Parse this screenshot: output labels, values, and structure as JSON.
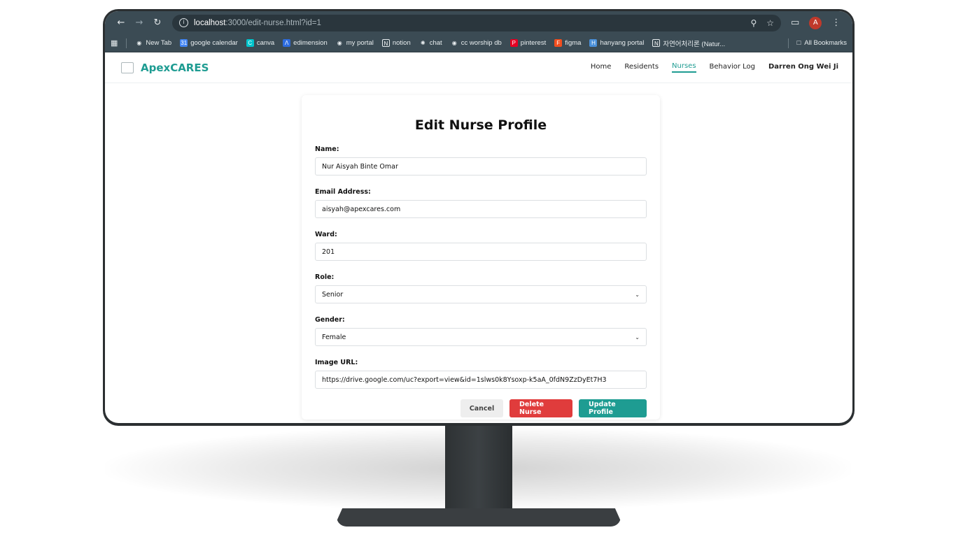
{
  "browser": {
    "url_host": "localhost",
    "url_rest": ":3000/edit-nurse.html?id=1"
  },
  "bookmarks": [
    {
      "label": "New Tab",
      "icon": "globe-icon",
      "color": "#e8edef"
    },
    {
      "label": "google calendar",
      "icon": "calendar-icon",
      "color": "#4285f4"
    },
    {
      "label": "canva",
      "icon": "canva-icon",
      "color": "#00c4cc"
    },
    {
      "label": "edimension",
      "icon": "edimension-icon",
      "color": "#2d6cdf"
    },
    {
      "label": "my portal",
      "icon": "globe-icon",
      "color": "#e8edef"
    },
    {
      "label": "notion",
      "icon": "notion-icon",
      "color": "#ffffff"
    },
    {
      "label": "chat",
      "icon": "chatgpt-icon",
      "color": "#e8edef"
    },
    {
      "label": "cc worship db",
      "icon": "globe-icon",
      "color": "#e8edef"
    },
    {
      "label": "pinterest",
      "icon": "pinterest-icon",
      "color": "#e60023"
    },
    {
      "label": "figma",
      "icon": "figma-icon",
      "color": "#f24e1e"
    },
    {
      "label": "hanyang portal",
      "icon": "hanyang-icon",
      "color": "#4a90d9"
    },
    {
      "label": "자연어처리론 (Natur...",
      "icon": "notion-icon",
      "color": "#ffffff"
    }
  ],
  "bookmarks_all": "All Bookmarks",
  "app": {
    "brand": "ApexCARES",
    "nav": [
      "Home",
      "Residents",
      "Nurses",
      "Behavior Log"
    ],
    "active_nav": "Nurses",
    "user": "Darren Ong Wei Jie",
    "accent": "#1e9c92"
  },
  "form": {
    "title": "Edit Nurse Profile",
    "name_label": "Name:",
    "name_value": "Nur Aisyah Binte Omar",
    "email_label": "Email Address:",
    "email_value": "aisyah@apexcares.com",
    "ward_label": "Ward:",
    "ward_value": "201",
    "role_label": "Role:",
    "role_value": "Senior",
    "gender_label": "Gender:",
    "gender_value": "Female",
    "image_label": "Image URL:",
    "image_value": "https://drive.google.com/uc?export=view&id=1slws0k8Ysoxp-k5aA_0fdN9ZzDyEt7H3",
    "cancel_label": "Cancel",
    "delete_label": "Delete Nurse",
    "update_label": "Update Profile",
    "delete_color": "#e03c3c"
  }
}
